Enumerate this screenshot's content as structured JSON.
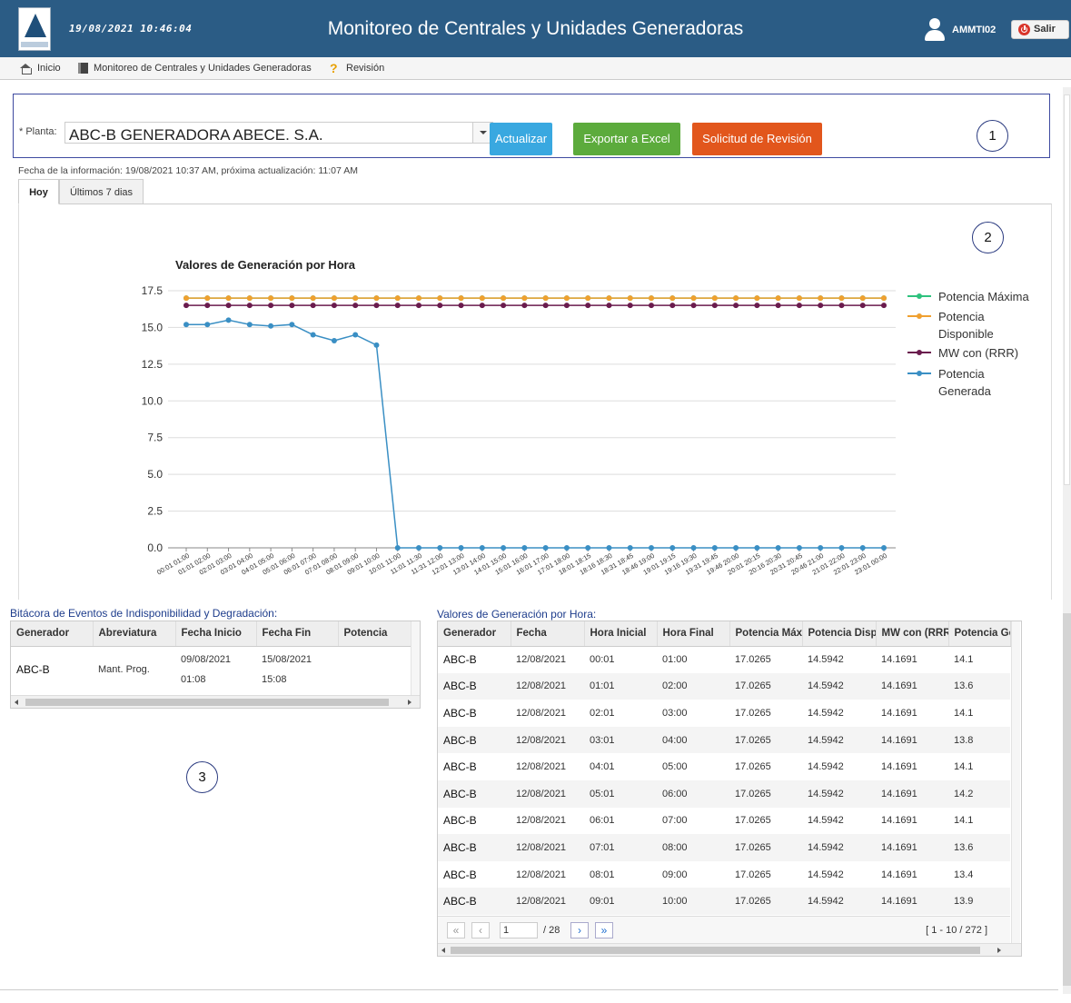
{
  "header": {
    "datetime": "19/08/2021 10:46:04",
    "title": "Monitoreo de Centrales y Unidades Generadoras",
    "username": "AMMTI02",
    "logout_label": "Salir",
    "bg_color": "#2b5c85"
  },
  "breadcrumb": {
    "home": "Inicio",
    "module": "Monitoreo de Centrales y Unidades Generadoras",
    "current": "Revisión"
  },
  "filters": {
    "planta_label": "* Planta:",
    "planta_value": "ABC-B GENERADORA ABECE. S.A.",
    "btn_update": "Actualizar",
    "btn_excel": "Exportar a Excel",
    "btn_review": "Solicitud de Revisión"
  },
  "annotations": {
    "n1": "1",
    "n2": "2",
    "n3": "3"
  },
  "info_line": "Fecha de la información: 19/08/2021 10:37 AM, próxima actualización: 11:07 AM",
  "tabs": {
    "today": "Hoy",
    "last7": "Últimos 7 dias"
  },
  "chart_data": {
    "type": "line",
    "title": "Valores de Generación por Hora",
    "xlabel": "",
    "ylabel": "",
    "ylim": [
      0,
      17.5
    ],
    "yticks": [
      "0.0",
      "2.5",
      "5.0",
      "7.5",
      "10.0",
      "12.5",
      "15.0",
      "17.5"
    ],
    "legend_position": "right",
    "grid": true,
    "x": [
      "00:01 01:00",
      "01:01 02:00",
      "02:01 03:00",
      "03:01 04:00",
      "04:01 05:00",
      "05:01 06:00",
      "06:01 07:00",
      "07:01 08:00",
      "08:01 09:00",
      "09:01 10:00",
      "10:01 11:00",
      "11:01 11:30",
      "11:31 12:00",
      "12:01 13:00",
      "13:01 14:00",
      "14:01 15:00",
      "15:01 16:00",
      "16:01 17:00",
      "17:01 18:00",
      "18:01 18:15",
      "18:16 18:30",
      "18:31 18:45",
      "18:46 19:00",
      "19:01 19:15",
      "19:16 19:30",
      "19:31 19:45",
      "19:46 20:00",
      "20:01 20:15",
      "20:16 20:30",
      "20:31 20:45",
      "20:46 21:00",
      "21:01 22:00",
      "22:01 23:00",
      "23:01 00:00"
    ],
    "series": [
      {
        "name": "Potencia Máxima",
        "color": "#2ec27e",
        "values": [
          17.0,
          17.0,
          17.0,
          17.0,
          17.0,
          17.0,
          17.0,
          17.0,
          17.0,
          17.0,
          17.0,
          17.0,
          17.0,
          17.0,
          17.0,
          17.0,
          17.0,
          17.0,
          17.0,
          17.0,
          17.0,
          17.0,
          17.0,
          17.0,
          17.0,
          17.0,
          17.0,
          17.0,
          17.0,
          17.0,
          17.0,
          17.0,
          17.0,
          17.0
        ]
      },
      {
        "name": "Potencia Disponible",
        "color": "#f0a030",
        "values": [
          17.0,
          17.0,
          17.0,
          17.0,
          17.0,
          17.0,
          17.0,
          17.0,
          17.0,
          17.0,
          17.0,
          17.0,
          17.0,
          17.0,
          17.0,
          17.0,
          17.0,
          17.0,
          17.0,
          17.0,
          17.0,
          17.0,
          17.0,
          17.0,
          17.0,
          17.0,
          17.0,
          17.0,
          17.0,
          17.0,
          17.0,
          17.0,
          17.0,
          17.0
        ]
      },
      {
        "name": "MW con (RRR)",
        "color": "#6a1b4d",
        "values": [
          16.5,
          16.5,
          16.5,
          16.5,
          16.5,
          16.5,
          16.5,
          16.5,
          16.5,
          16.5,
          16.5,
          16.5,
          16.5,
          16.5,
          16.5,
          16.5,
          16.5,
          16.5,
          16.5,
          16.5,
          16.5,
          16.5,
          16.5,
          16.5,
          16.5,
          16.5,
          16.5,
          16.5,
          16.5,
          16.5,
          16.5,
          16.5,
          16.5,
          16.5
        ]
      },
      {
        "name": "Potencia Generada",
        "color": "#3a8fc4",
        "values": [
          15.2,
          15.2,
          15.5,
          15.2,
          15.1,
          15.2,
          14.5,
          14.1,
          14.5,
          13.8,
          0,
          0,
          0,
          0,
          0,
          0,
          0,
          0,
          0,
          0,
          0,
          0,
          0,
          0,
          0,
          0,
          0,
          0,
          0,
          0,
          0,
          0,
          0,
          0
        ]
      }
    ],
    "legend": [
      {
        "line1": "Potencia Máxima",
        "line2": ""
      },
      {
        "line1": "Potencia",
        "line2": "Disponible"
      },
      {
        "line1": "MW con (RRR)",
        "line2": ""
      },
      {
        "line1": "Potencia",
        "line2": "Generada"
      }
    ]
  },
  "events_grid": {
    "caption": "Bitácora de Eventos de Indisponibilidad y Degradación:",
    "columns": [
      "Generador",
      "Abreviatura",
      "Fecha Inicio",
      "Fecha Fin",
      "Potencia"
    ],
    "rows": [
      {
        "generador": "ABC-B",
        "abreviatura": "Mant. Prog.",
        "inicio_fecha": "09/08/2021",
        "inicio_hora": "01:08",
        "fin_fecha": "15/08/2021",
        "fin_hora": "15:08",
        "potencia": ""
      }
    ]
  },
  "gen_grid": {
    "caption": "Valores de Generación por Hora:",
    "columns": [
      "Generador",
      "Fecha",
      "Hora Inicial",
      "Hora Final",
      "Potencia Máxi",
      "Potencia Disp",
      "MW con (RRR)",
      "Potencia Ge"
    ],
    "rows": [
      [
        "ABC-B",
        "12/08/2021",
        "00:01",
        "01:00",
        "17.0265",
        "14.5942",
        "14.1691",
        "14.1"
      ],
      [
        "ABC-B",
        "12/08/2021",
        "01:01",
        "02:00",
        "17.0265",
        "14.5942",
        "14.1691",
        "13.6"
      ],
      [
        "ABC-B",
        "12/08/2021",
        "02:01",
        "03:00",
        "17.0265",
        "14.5942",
        "14.1691",
        "14.1"
      ],
      [
        "ABC-B",
        "12/08/2021",
        "03:01",
        "04:00",
        "17.0265",
        "14.5942",
        "14.1691",
        "13.8"
      ],
      [
        "ABC-B",
        "12/08/2021",
        "04:01",
        "05:00",
        "17.0265",
        "14.5942",
        "14.1691",
        "14.1"
      ],
      [
        "ABC-B",
        "12/08/2021",
        "05:01",
        "06:00",
        "17.0265",
        "14.5942",
        "14.1691",
        "14.2"
      ],
      [
        "ABC-B",
        "12/08/2021",
        "06:01",
        "07:00",
        "17.0265",
        "14.5942",
        "14.1691",
        "14.1"
      ],
      [
        "ABC-B",
        "12/08/2021",
        "07:01",
        "08:00",
        "17.0265",
        "14.5942",
        "14.1691",
        "13.6"
      ],
      [
        "ABC-B",
        "12/08/2021",
        "08:01",
        "09:00",
        "17.0265",
        "14.5942",
        "14.1691",
        "13.4"
      ],
      [
        "ABC-B",
        "12/08/2021",
        "09:01",
        "10:00",
        "17.0265",
        "14.5942",
        "14.1691",
        "13.9"
      ]
    ],
    "pager": {
      "page": "1",
      "total_pages": "/ 28",
      "range": "[ 1 - 10 / 272 ]"
    }
  }
}
